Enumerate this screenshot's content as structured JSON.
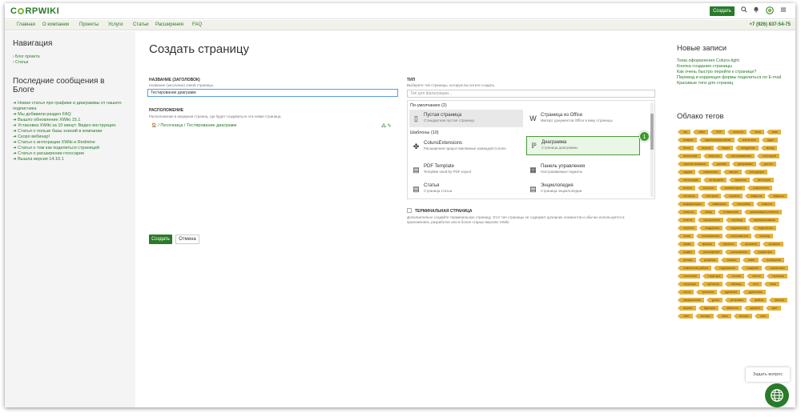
{
  "header": {
    "logo": "CORPWIKI",
    "create_button": "Создать",
    "icons": [
      "search-icon",
      "bell-icon",
      "user-icon",
      "menu-icon"
    ]
  },
  "nav": {
    "items": [
      "Главная",
      "О компании",
      "Проекты",
      "Услуги",
      "Статьи",
      "Расширения",
      "FAQ"
    ],
    "phone": "+7 (926) 837-54-75"
  },
  "left": {
    "nav_title": "Навигация",
    "links": [
      "› Блог проекта",
      "› Статьи"
    ],
    "blog_title": "Последние сообщения в Блоге",
    "posts": [
      "➔ Новая статья про графики и диаграммы от нашего подписчика",
      "➔ Мы добавили раздел FAQ",
      "➔ Вышло обновление XWiki 15.1",
      "➔ Установка XWiki за 10 минут. Видео инструкция.",
      "➔ Статья о пользе базы знаний в компании",
      "➔ Скоро вебинар!",
      "➔ Статья о интеграции XWiki и Redmine",
      "➔ Статья о том как поделиться страницей",
      "➔ Статья о расширении глоссарие",
      "➔ Вышла версия 14.10.1"
    ]
  },
  "form": {
    "page_title": "Создать страницу",
    "name_label": "НАЗВАНИЕ (ЗАГОЛОВОК)",
    "name_hint": "Название (заголовок) новой страницы.",
    "name_value": "Тестирование диаграмм",
    "location_label": "РАСПОЛОЖЕНИЕ",
    "location_hint": "Расположение в иерархии страниц, где будет создаваться эта новая страница.",
    "location_path": "🏠 / Песочница / Тестирование диаграмм",
    "type_label": "ТИП",
    "type_hint": "Выберите тип страницы, которую вы хотите создать.",
    "filter_placeholder": "Тип для фильтрации...",
    "group_default": "По-умолчанию (2)",
    "group_templates": "Шаблоны (10)",
    "tiles": [
      {
        "name": "Пустая страница",
        "desc": "Стандартная пустая страница",
        "icon": "page-icon"
      },
      {
        "name": "Страница из Office",
        "desc": "Импорт документов Office в вику страницы",
        "icon": "word-icon"
      },
      {
        "name": "ColunsExtensions",
        "desc": "Расширения предоставляемые командой Coruns",
        "icon": "extension-icon"
      },
      {
        "name": "Диаграмма",
        "desc": "Страница диаграммы",
        "icon": "diagram-icon"
      },
      {
        "name": "PDF Template",
        "desc": "Template used by PDF export",
        "icon": "pdf-icon"
      },
      {
        "name": "Панель управления",
        "desc": "Настраиваемые гаджеты",
        "icon": "dashboard-icon"
      },
      {
        "name": "Статья",
        "desc": "Страница статьи",
        "icon": "article-icon"
      },
      {
        "name": "Энциклопедия",
        "desc": "Страница энциклопедии",
        "icon": "encyclopedia-icon"
      }
    ],
    "badge": "1",
    "terminal_label": "ТЕРМИНАЛЬНАЯ СТРАНИЦА",
    "terminal_hint": "Дополнительно создайте терминальную страницу. Этот тип страницы не содержит дочерних элементов и обычно используется в приложениях, разработке или в более старых версиях XWiki.",
    "create_button": "Создать",
    "cancel_button": "Отмена"
  },
  "right": {
    "new_title": "Новые записи",
    "new_links": [
      "Тема оформления Coluns-light",
      "Кнопка создания страницы",
      "Как очень быстро перейти к странице?",
      "Перевод и коррекция формы поделиться по E-mail",
      "Красивые теги для страниц"
    ],
    "tags_title": "Облако тегов",
    "tags": [
      "faq",
      "office",
      "PDF",
      "аналоги",
      "база",
      "вики",
      "возврат",
      "администрирование",
      "аналитика",
      "аудит",
      "блоги",
      "версии",
      "видео",
      "внедрение",
      "вклад",
      "включение",
      "вопросы",
      "настраиваемые",
      "глоссарий",
      "горячие клавиши",
      "данные",
      "диаграммы",
      "доступ",
      "задачи",
      "изменения",
      "импорт",
      "инструкция",
      "интеграция",
      "интерфейс",
      "картинки",
      "категории",
      "кнопки",
      "колонки",
      "комментарии",
      "компоненты",
      "контакты",
      "контроль",
      "корзина",
      "макросы",
      "макросы",
      "модификация",
      "навигация",
      "настройки",
      "новости",
      "новость",
      "обзор",
      "оглавление",
      "организация контента",
      "ответы",
      "оформление",
      "перевод",
      "переименование",
      "перенос",
      "поддержка",
      "подписаться",
      "поделиться",
      "поиск",
      "пользователи",
      "пользователь",
      "помощь",
      "права",
      "пример",
      "проекты",
      "просмотр",
      "профиль",
      "раздел",
      "расширение",
      "расширения",
      "редакторы",
      "релизы",
      "решения",
      "скачать",
      "совет",
      "сообщения",
      "совместная работа",
      "содержание",
      "создание",
      "сортировка",
      "сочетания",
      "структура",
      "ссылки",
      "статьи",
      "страница",
      "структура",
      "субтитры",
      "таблицы",
      "теги",
      "темы",
      "тесты",
      "тренинги",
      "удаление",
      "удаленная",
      "уведомления",
      "уроки",
      "установка",
      "файлы",
      "фильтр",
      "формы",
      "функции",
      "шаблоны",
      "шрифты",
      "цвет",
      "xwiki",
      "экспорт",
      "язык",
      "экспорт",
      "эссе"
    ],
    "help_bubble": "Задать вопрос"
  }
}
